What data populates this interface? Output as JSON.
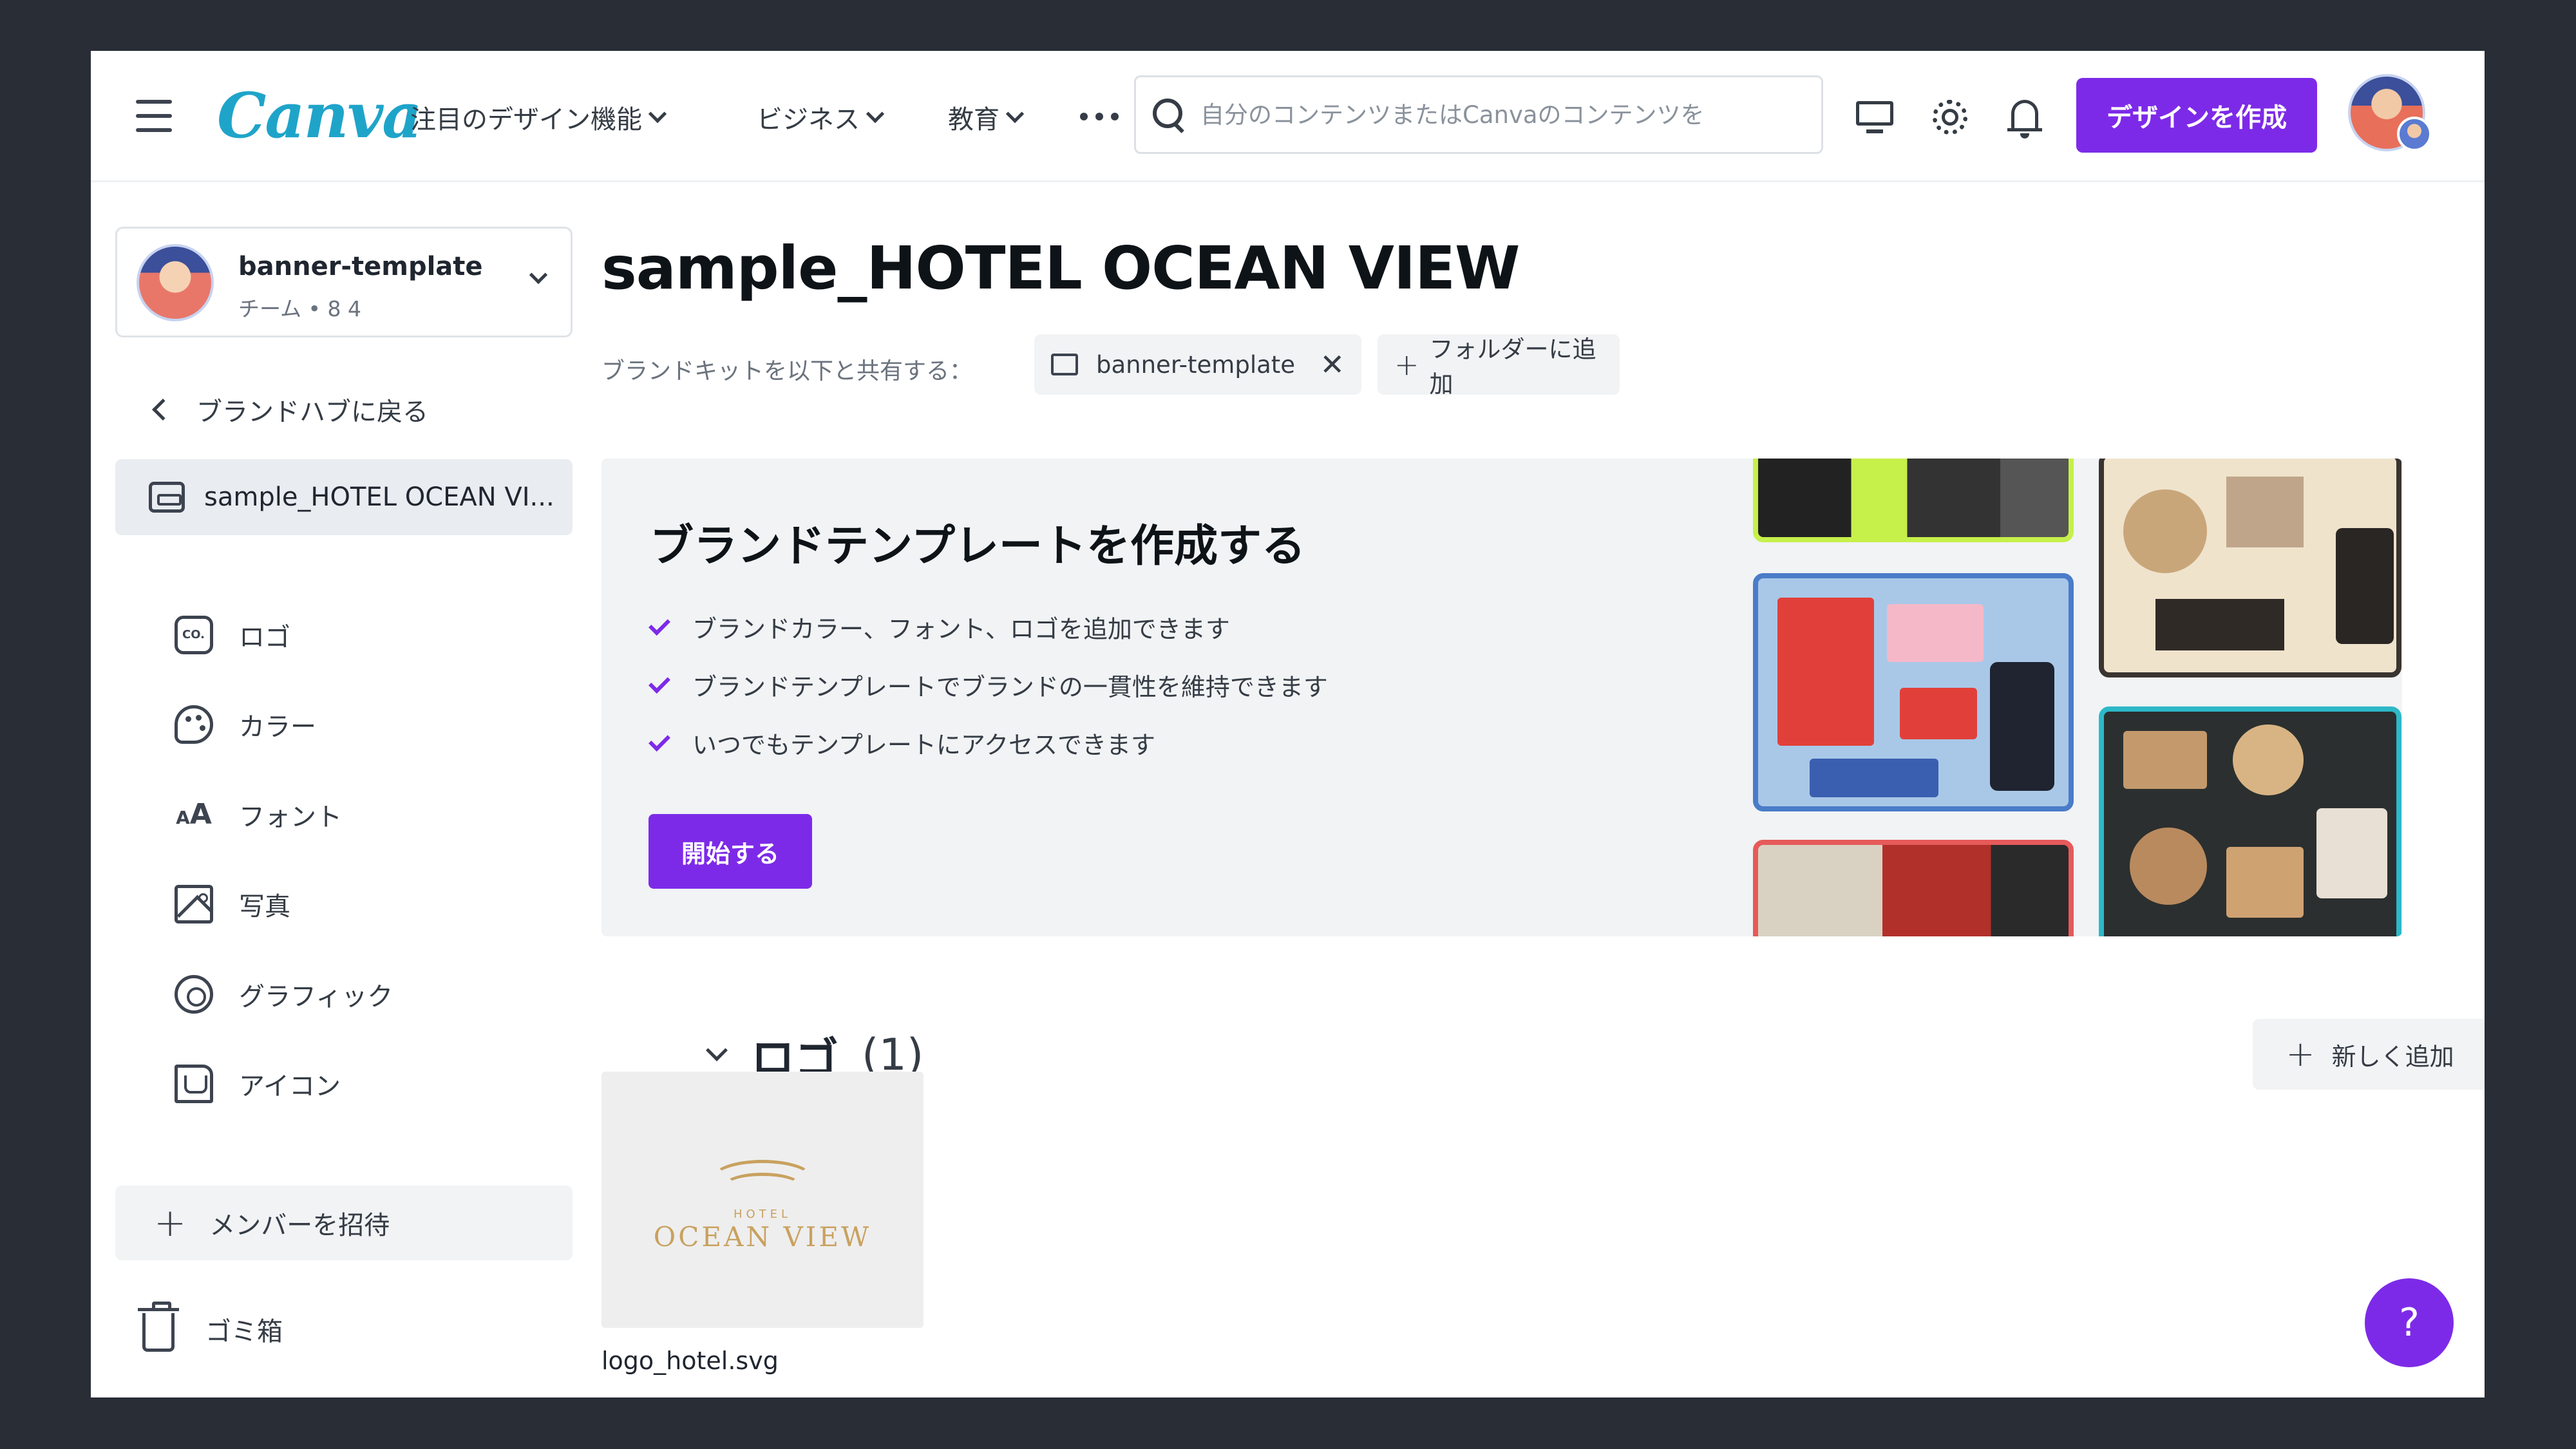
{
  "header": {
    "logo": "Canva",
    "nav": [
      {
        "label": "注目のデザイン機能"
      },
      {
        "label": "ビジネス"
      },
      {
        "label": "教育"
      }
    ],
    "search_placeholder": "自分のコンテンツまたはCanvaのコンテンツを",
    "create_button": "デザインを作成"
  },
  "sidebar": {
    "team": {
      "name": "banner-template",
      "meta": "チーム • 8 4"
    },
    "back": "ブランドハブに戻る",
    "active_kit": "sample_HOTEL OCEAN VI...",
    "items": [
      {
        "label": "ロゴ",
        "icon": "logo-icon"
      },
      {
        "label": "カラー",
        "icon": "palette-icon"
      },
      {
        "label": "フォント",
        "icon": "font-icon"
      },
      {
        "label": "写真",
        "icon": "photo-icon"
      },
      {
        "label": "グラフィック",
        "icon": "graphic-icon"
      },
      {
        "label": "アイコン",
        "icon": "icon-icon"
      }
    ],
    "invite": "メンバーを招待",
    "trash": "ゴミ箱"
  },
  "main": {
    "title": "sample_HOTEL OCEAN VIEW",
    "share_label": "ブランドキットを以下と共有する：",
    "share_chip": "banner-template",
    "add_folder": "フォルダーに追加",
    "banner": {
      "title": "ブランドテンプレートを作成する",
      "features": [
        "ブランドカラー、フォント、ロゴを追加できます",
        "ブランドテンプレートでブランドの一貫性を維持できます",
        "いつでもテンプレートにアクセスできます"
      ],
      "button": "開始する"
    },
    "logo_section": {
      "title": "ロゴ",
      "count": "(1)",
      "add_button": "新しく追加"
    },
    "logo_file": {
      "name": "logo_hotel.svg",
      "mark_small": "HOTEL",
      "mark_big": "OCEAN VIEW"
    }
  },
  "help": "?",
  "colors": {
    "accent": "#7d2ae8",
    "logo": "#1fa4c9",
    "gold": "#c9a15f"
  }
}
